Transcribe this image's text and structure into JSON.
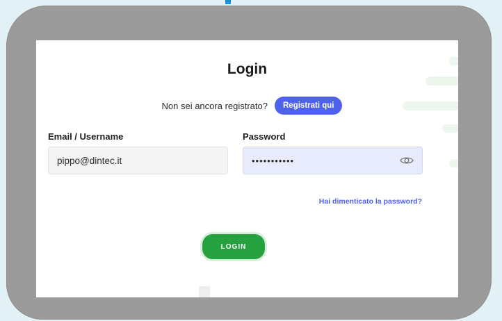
{
  "login": {
    "title": "Login",
    "register_question": "Non sei ancora registrato?",
    "register_button": "Registrati qui",
    "email_label": "Email / Username",
    "email_value": "pippo@dintec.it",
    "password_label": "Password",
    "password_value": "•••••••••••",
    "forgot_link": "Hai dimenticato la password?",
    "login_button": "LOGIN"
  },
  "icons": {
    "password_toggle": "eye-icon"
  },
  "colors": {
    "accent_blue": "#4f62ee",
    "login_green": "#26a140",
    "frame_gray": "#9b9b9b",
    "background": "#e2f1f6"
  }
}
